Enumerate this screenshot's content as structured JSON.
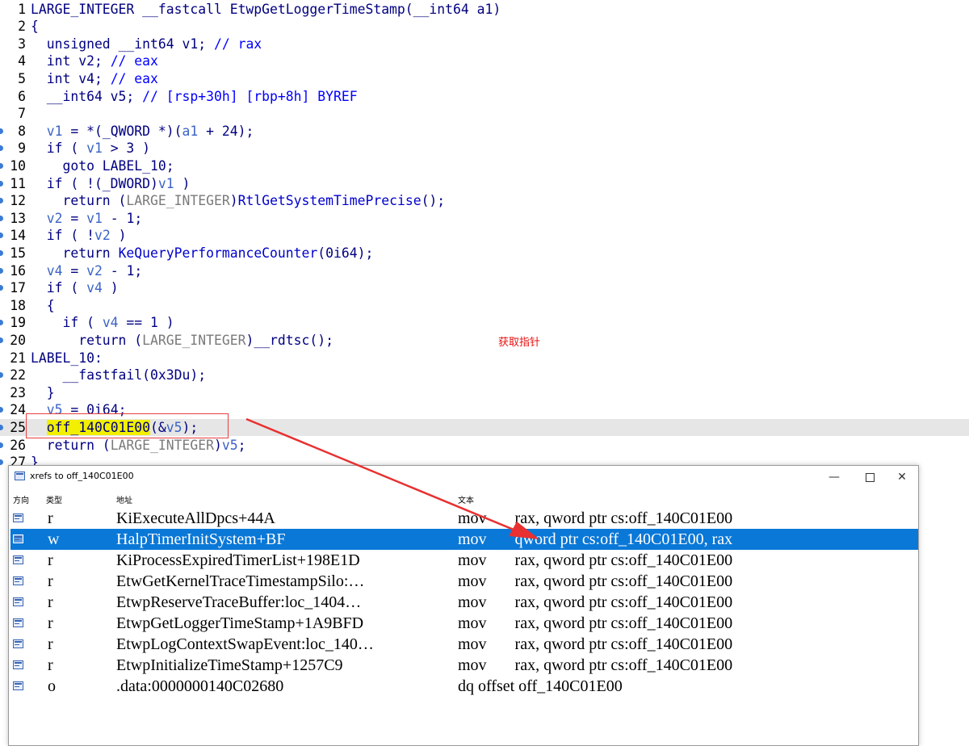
{
  "code": {
    "lines": [
      {
        "n": "1",
        "dot": false,
        "hl": false,
        "parts": [
          {
            "t": "LARGE_INTEGER __fastcall EtwpGetLoggerTimeStamp(__int64 a1)"
          }
        ]
      },
      {
        "n": "2",
        "dot": false,
        "hl": false,
        "parts": [
          {
            "t": "{"
          }
        ]
      },
      {
        "n": "3",
        "dot": false,
        "hl": false,
        "parts": [
          {
            "t": "  unsigned __int64 v1; "
          },
          {
            "t": "// rax",
            "c": "cm"
          }
        ]
      },
      {
        "n": "4",
        "dot": false,
        "hl": false,
        "parts": [
          {
            "t": "  int v2; "
          },
          {
            "t": "// eax",
            "c": "cm"
          }
        ]
      },
      {
        "n": "5",
        "dot": false,
        "hl": false,
        "parts": [
          {
            "t": "  int v4; "
          },
          {
            "t": "// eax",
            "c": "cm"
          }
        ]
      },
      {
        "n": "6",
        "dot": false,
        "hl": false,
        "parts": [
          {
            "t": "  __int64 v5; "
          },
          {
            "t": "// [rsp+30h] [rbp+8h] BYREF",
            "c": "cm"
          }
        ]
      },
      {
        "n": "7",
        "dot": false,
        "hl": false,
        "parts": [
          {
            "t": ""
          }
        ]
      },
      {
        "n": "8",
        "dot": true,
        "hl": false,
        "parts": [
          {
            "t": "  "
          },
          {
            "t": "v1",
            "c": "vv"
          },
          {
            "t": " = *(_QWORD *)("
          },
          {
            "t": "a1",
            "c": "vv"
          },
          {
            "t": " + 24);"
          }
        ]
      },
      {
        "n": "9",
        "dot": true,
        "hl": false,
        "parts": [
          {
            "t": "  if ( "
          },
          {
            "t": "v1",
            "c": "vv"
          },
          {
            "t": " > 3 )"
          }
        ]
      },
      {
        "n": "10",
        "dot": true,
        "hl": false,
        "parts": [
          {
            "t": "    goto LABEL_10;"
          }
        ]
      },
      {
        "n": "11",
        "dot": true,
        "hl": false,
        "parts": [
          {
            "t": "  if ( !(_DWORD)"
          },
          {
            "t": "v1",
            "c": "vv"
          },
          {
            "t": " )"
          }
        ]
      },
      {
        "n": "12",
        "dot": true,
        "hl": false,
        "parts": [
          {
            "t": "    return ("
          },
          {
            "t": "LARGE_INTEGER",
            "c": "cgr"
          },
          {
            "t": ")"
          },
          {
            "t": "RtlGetSystemTimePrecise",
            "c": "fn"
          },
          {
            "t": "();"
          }
        ]
      },
      {
        "n": "13",
        "dot": true,
        "hl": false,
        "parts": [
          {
            "t": "  "
          },
          {
            "t": "v2",
            "c": "vv"
          },
          {
            "t": " = "
          },
          {
            "t": "v1",
            "c": "vv"
          },
          {
            "t": " - 1;"
          }
        ]
      },
      {
        "n": "14",
        "dot": true,
        "hl": false,
        "parts": [
          {
            "t": "  if ( !"
          },
          {
            "t": "v2",
            "c": "vv"
          },
          {
            "t": " )"
          }
        ]
      },
      {
        "n": "15",
        "dot": true,
        "hl": false,
        "parts": [
          {
            "t": "    return "
          },
          {
            "t": "KeQueryPerformanceCounter",
            "c": "fn"
          },
          {
            "t": "(0i64);"
          }
        ]
      },
      {
        "n": "16",
        "dot": true,
        "hl": false,
        "parts": [
          {
            "t": "  "
          },
          {
            "t": "v4",
            "c": "vv"
          },
          {
            "t": " = "
          },
          {
            "t": "v2",
            "c": "vv"
          },
          {
            "t": " - 1;"
          }
        ]
      },
      {
        "n": "17",
        "dot": true,
        "hl": false,
        "parts": [
          {
            "t": "  if ( "
          },
          {
            "t": "v4",
            "c": "vv"
          },
          {
            "t": " )"
          }
        ]
      },
      {
        "n": "18",
        "dot": false,
        "hl": false,
        "parts": [
          {
            "t": "  {"
          }
        ]
      },
      {
        "n": "19",
        "dot": true,
        "hl": false,
        "parts": [
          {
            "t": "    if ( "
          },
          {
            "t": "v4",
            "c": "vv"
          },
          {
            "t": " == 1 )"
          }
        ]
      },
      {
        "n": "20",
        "dot": true,
        "hl": false,
        "parts": [
          {
            "t": "      return ("
          },
          {
            "t": "LARGE_INTEGER",
            "c": "cgr"
          },
          {
            "t": ")__rdtsc();"
          }
        ]
      },
      {
        "n": "21",
        "dot": false,
        "hl": false,
        "parts": [
          {
            "t": "LABEL_10:"
          }
        ]
      },
      {
        "n": "22",
        "dot": true,
        "hl": false,
        "parts": [
          {
            "t": "    __fastfail(0x3Du);"
          }
        ]
      },
      {
        "n": "23",
        "dot": false,
        "hl": false,
        "parts": [
          {
            "t": "  }"
          }
        ]
      },
      {
        "n": "24",
        "dot": true,
        "hl": false,
        "parts": [
          {
            "t": "  "
          },
          {
            "t": "v5",
            "c": "vv"
          },
          {
            "t": " = 0i64;"
          }
        ]
      },
      {
        "n": "25",
        "dot": true,
        "hl": true,
        "parts": [
          {
            "t": "  "
          },
          {
            "t": "off_140C01E00",
            "c": "gl"
          },
          {
            "t": "(&"
          },
          {
            "t": "v5",
            "c": "vv"
          },
          {
            "t": ");"
          }
        ]
      },
      {
        "n": "26",
        "dot": true,
        "hl": false,
        "parts": [
          {
            "t": "  return ("
          },
          {
            "t": "LARGE_INTEGER",
            "c": "cgr"
          },
          {
            "t": ")"
          },
          {
            "t": "v5",
            "c": "vv"
          },
          {
            "t": ";"
          }
        ]
      },
      {
        "n": "27",
        "dot": true,
        "hl": false,
        "parts": [
          {
            "t": "}"
          }
        ]
      }
    ]
  },
  "annotation": {
    "note": "获取指针",
    "color": "#e81010"
  },
  "xrefs_window": {
    "title": "xrefs to off_140C01E00",
    "controls": {
      "minimize": "—",
      "maximize": "□",
      "close": "✕"
    },
    "columns": {
      "dir": "方向",
      "type": "类型",
      "addr": "地址",
      "text": "文本"
    },
    "selection_color": "#0a78d7",
    "rows": [
      {
        "type": "r",
        "addr": "KiExecuteAllDpcs+44A",
        "text": "mov       rax, qword ptr cs:off_140C01E00",
        "selected": false
      },
      {
        "type": "w",
        "addr": "HalpTimerInitSystem+BF",
        "text": "mov       qword ptr cs:off_140C01E00, rax",
        "selected": true
      },
      {
        "type": "r",
        "addr": "KiProcessExpiredTimerList+198E1D",
        "text": "mov       rax, qword ptr cs:off_140C01E00",
        "selected": false
      },
      {
        "type": "r",
        "addr": "EtwGetKernelTraceTimestampSilo:…",
        "text": "mov       rax, qword ptr cs:off_140C01E00",
        "selected": false
      },
      {
        "type": "r",
        "addr": "EtwpReserveTraceBuffer:loc_1404…",
        "text": "mov       rax, qword ptr cs:off_140C01E00",
        "selected": false
      },
      {
        "type": "r",
        "addr": "EtwpGetLoggerTimeStamp+1A9BFD",
        "text": "mov       rax, qword ptr cs:off_140C01E00",
        "selected": false
      },
      {
        "type": "r",
        "addr": "EtwpLogContextSwapEvent:loc_140…",
        "text": "mov       rax, qword ptr cs:off_140C01E00",
        "selected": false
      },
      {
        "type": "r",
        "addr": "EtwpInitializeTimeStamp+1257C9",
        "text": "mov       rax, qword ptr cs:off_140C01E00",
        "selected": false
      },
      {
        "type": "o",
        "addr": ".data:0000000140C02680",
        "text": "dq offset off_140C01E00",
        "selected": false
      }
    ]
  }
}
